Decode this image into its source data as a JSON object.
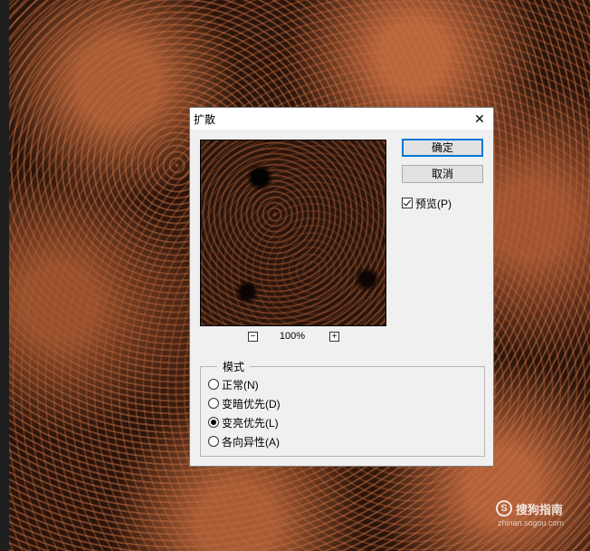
{
  "dialog": {
    "title": "扩散",
    "close_label": "✕",
    "ok_label": "确定",
    "cancel_label": "取消",
    "preview_label": "预览(P)",
    "preview_checked": true,
    "zoom": {
      "minus": "−",
      "plus": "+",
      "level": "100%"
    },
    "mode": {
      "legend": "模式",
      "options": [
        {
          "label": "正常(N)",
          "checked": false
        },
        {
          "label": "变暗优先(D)",
          "checked": false
        },
        {
          "label": "变亮优先(L)",
          "checked": true
        },
        {
          "label": "各向异性(A)",
          "checked": false
        }
      ]
    }
  },
  "watermark": {
    "logo": "S",
    "brand": "搜狗指南",
    "url": "zhinan.sogou.com"
  },
  "colors": {
    "accent": "#0078d7",
    "dialog_bg": "#f0f0f0",
    "canvas_bg": "#2a140a"
  }
}
